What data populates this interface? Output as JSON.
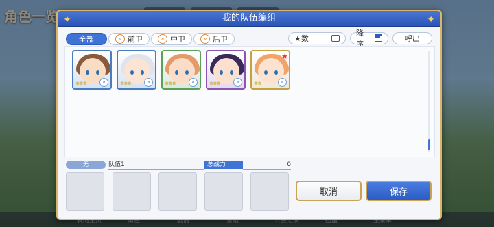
{
  "background": {
    "title": "角色一览",
    "nav_items": [
      "我的主页",
      "角色",
      "剧情",
      "冒险",
      "公会之家",
      "扭蛋",
      "主菜单"
    ]
  },
  "dialog": {
    "title": "我的队伍编组",
    "filters": [
      {
        "label": "全部",
        "icon": null,
        "active": true
      },
      {
        "label": "前卫",
        "icon": "front-guard-icon",
        "active": false
      },
      {
        "label": "中卫",
        "icon": "mid-guard-icon",
        "active": false
      },
      {
        "label": "后卫",
        "icon": "rear-guard-icon",
        "active": false
      }
    ],
    "sort_field": "★数",
    "sort_order": "降序",
    "recall": "呼出",
    "characters": [
      {
        "stars": 3,
        "hair": "#8a5a3a",
        "face": "#f9dcc4",
        "border": "#4a7cc0",
        "badge": false
      },
      {
        "stars": 3,
        "hair": "#dfe4ec",
        "face": "#fbe4d3",
        "border": "#4a7cc0",
        "badge": false
      },
      {
        "stars": 3,
        "hair": "#e59a6a",
        "face": "#fbdcc6",
        "border": "#5aa05a",
        "badge": false
      },
      {
        "stars": 3,
        "hair": "#3a2a5a",
        "face": "#fbe0cf",
        "border": "#8a56b0",
        "badge": false
      },
      {
        "stars": 2,
        "hair": "#f2a36a",
        "face": "#fde2cf",
        "border": "#c7a040",
        "badge": true
      }
    ],
    "team": {
      "status": "无",
      "name": "队伍1",
      "power_label": "总战力",
      "power_value": "0"
    },
    "cancel_label": "取消",
    "save_label": "保存"
  }
}
